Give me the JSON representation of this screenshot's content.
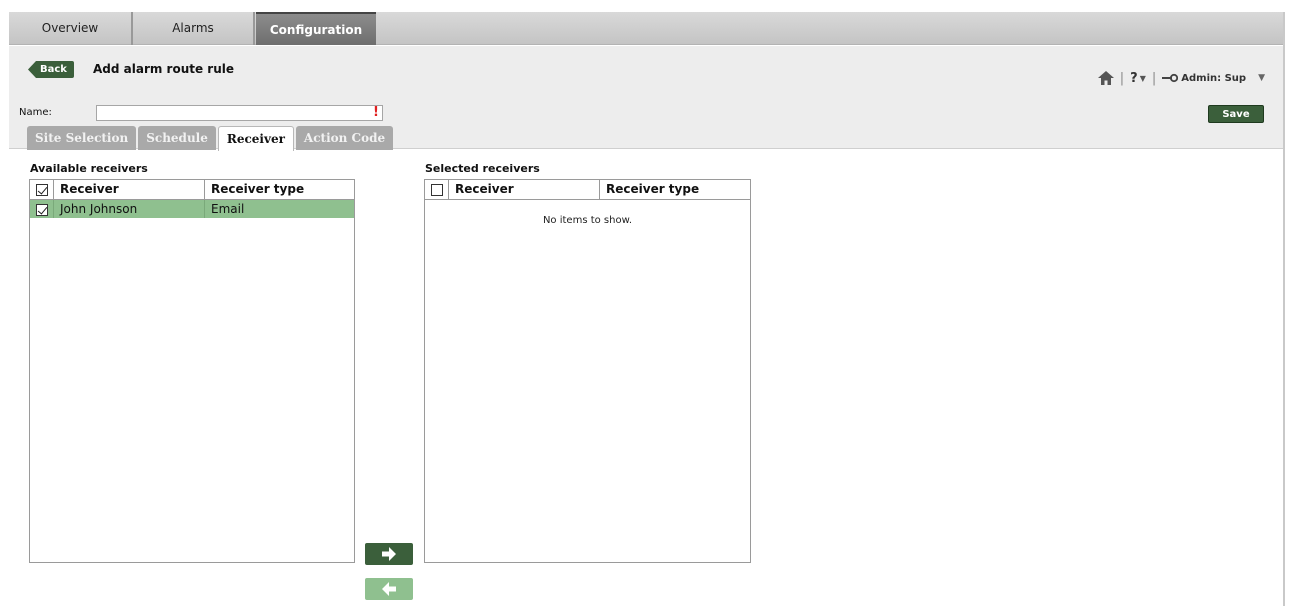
{
  "nav": {
    "tabs": [
      {
        "label": "Overview"
      },
      {
        "label": "Alarms"
      },
      {
        "label": "Configuration",
        "active": true
      }
    ]
  },
  "header": {
    "back_label": "Back",
    "title": "Add alarm route rule",
    "name_label": "Name:",
    "name_value": "",
    "required_marker": "!",
    "help_label": "?",
    "user_label": "Admin: Sup",
    "save_label": "Save"
  },
  "subtabs": [
    {
      "label": "Site Selection"
    },
    {
      "label": "Schedule"
    },
    {
      "label": "Receiver",
      "active": true
    },
    {
      "label": "Action Code"
    }
  ],
  "available": {
    "title": "Available receivers",
    "header_checked": true,
    "columns": [
      "Receiver",
      "Receiver type"
    ],
    "rows": [
      {
        "checked": true,
        "receiver": "John Johnson",
        "type": "Email"
      }
    ]
  },
  "selected": {
    "title": "Selected receivers",
    "header_checked": false,
    "columns": [
      "Receiver",
      "Receiver type"
    ],
    "empty_text": "No items to show."
  },
  "colors": {
    "accent_dark_green": "#3b5f3b",
    "row_selected_green": "#8fc08f",
    "required_red": "#e02020"
  },
  "icons": {
    "home": "house-icon",
    "help": "help-icon",
    "key": "key-icon",
    "dropdown": "dropdown-icon",
    "move_right": "arrow-right-icon",
    "move_left": "arrow-left-icon"
  }
}
